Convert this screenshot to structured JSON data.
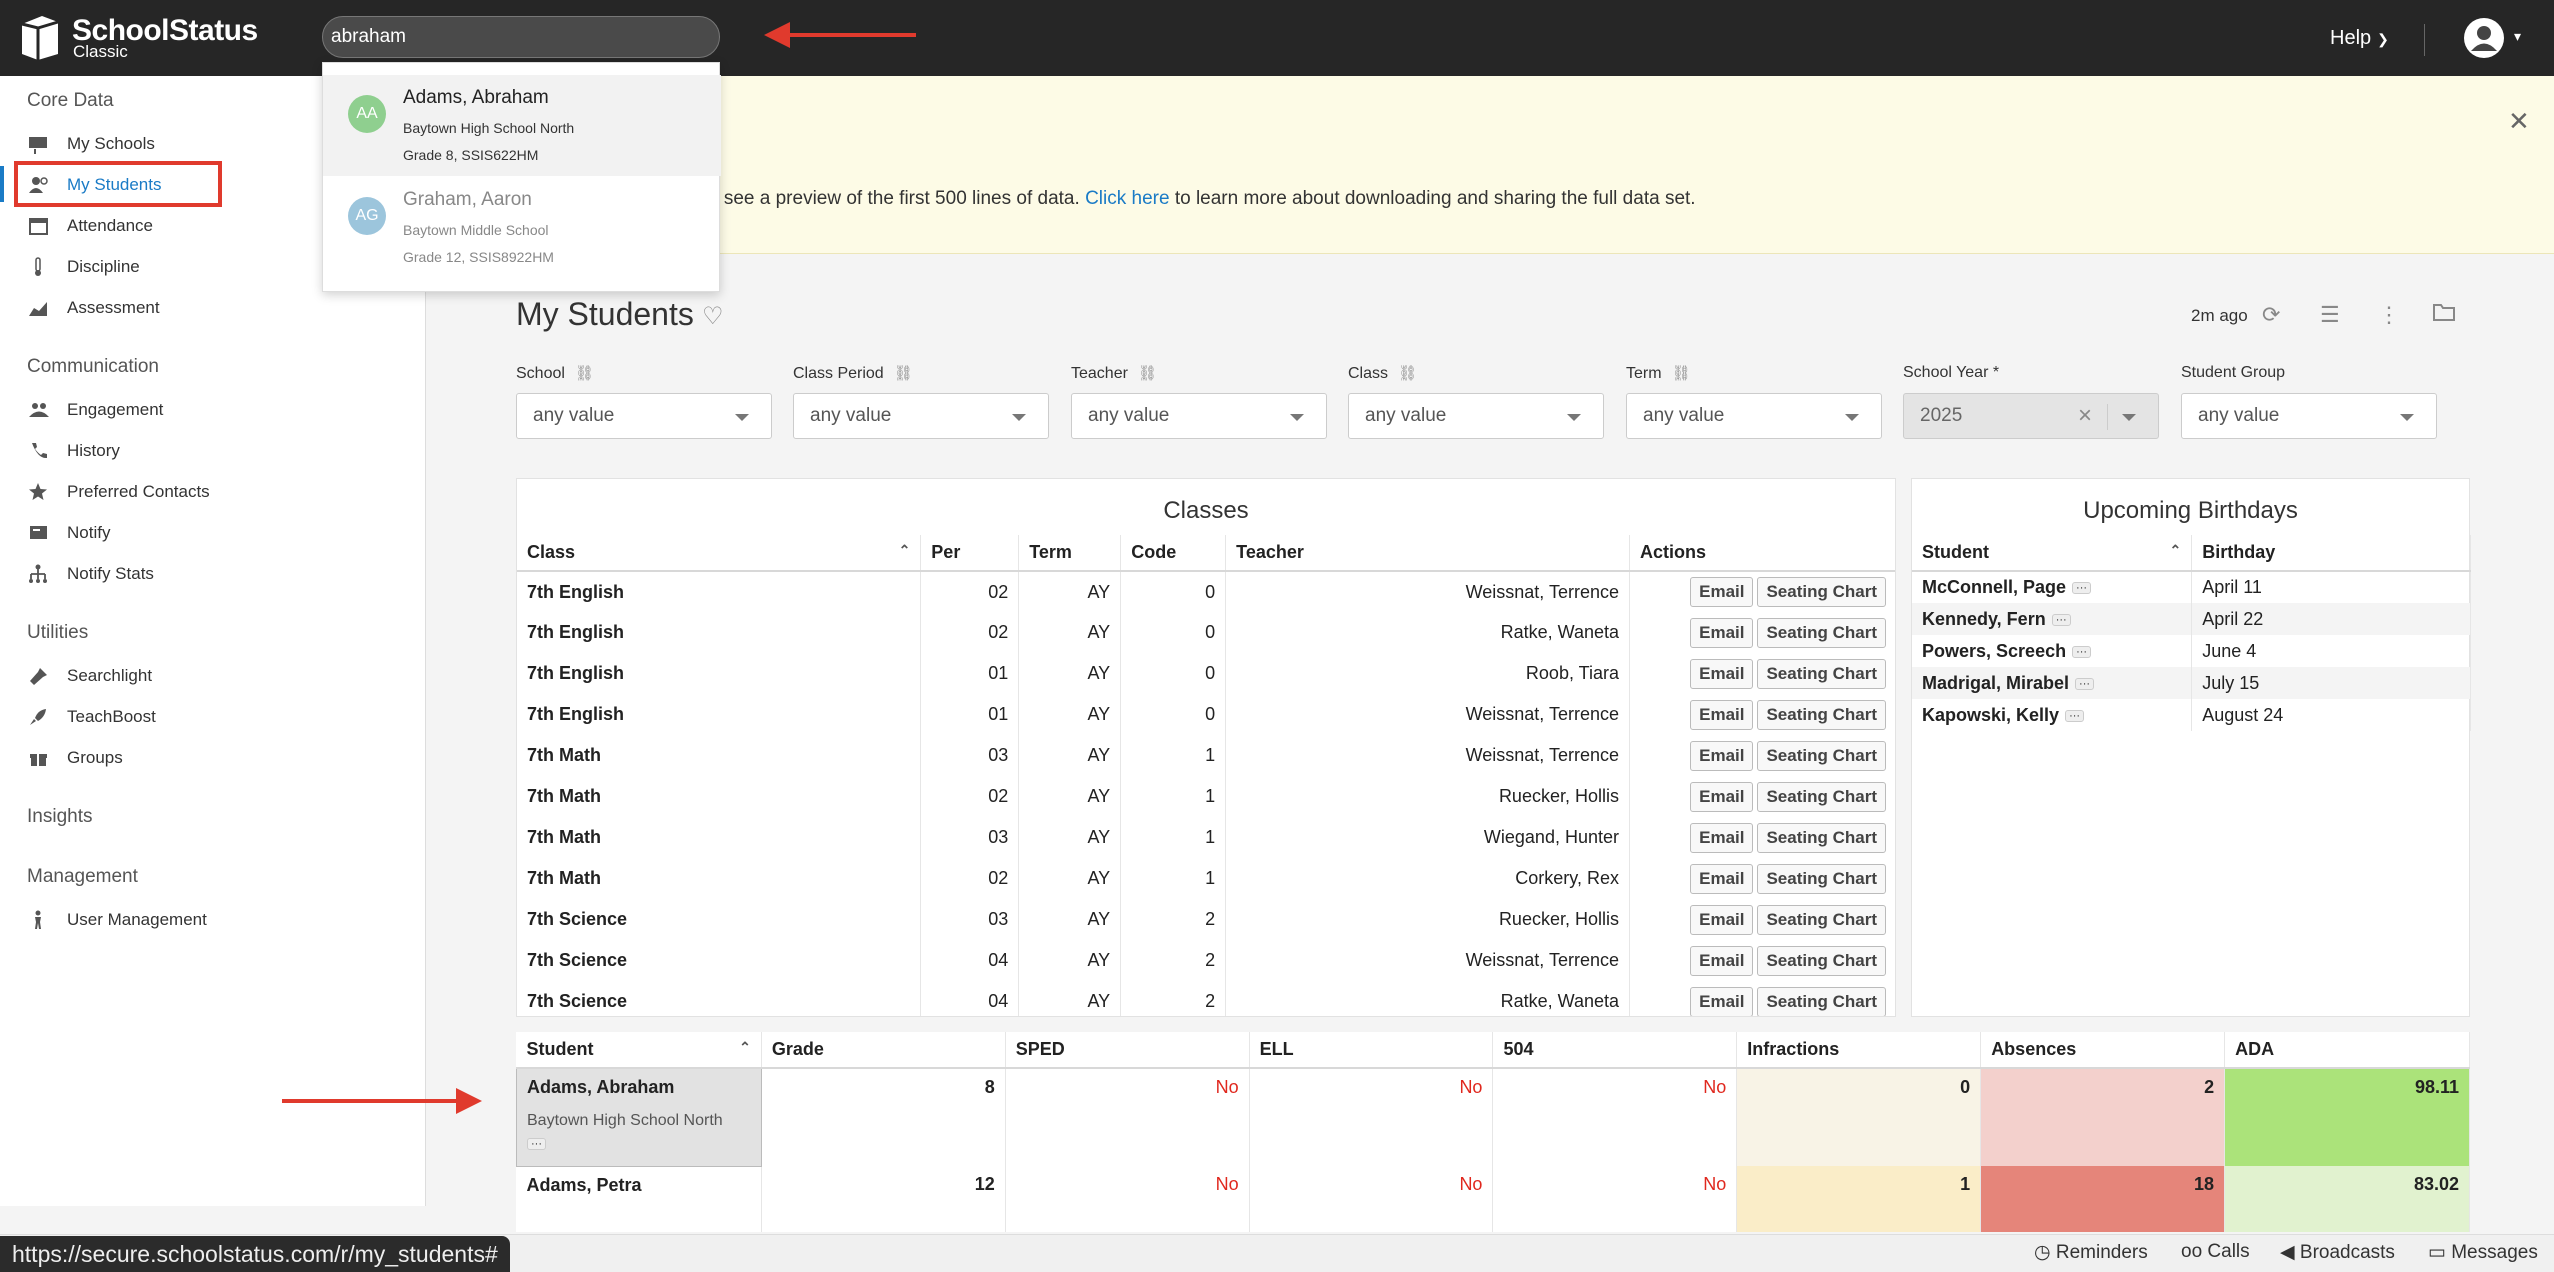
{
  "app": {
    "name": "SchoolStatus",
    "edition": "Classic"
  },
  "topbar": {
    "search_value": "abraham",
    "help_label": "Help"
  },
  "search_results": [
    {
      "initials": "AA",
      "name": "Adams, Abraham",
      "school": "Baytown High School North",
      "detail": "Grade 8, SSIS622HM",
      "color": "#8fcf8f"
    },
    {
      "initials": "AG",
      "name": "Graham, Aaron",
      "school": "Baytown Middle School",
      "detail": "Grade 12, SSIS8922HM",
      "color": "#9cc5dc"
    }
  ],
  "sidebar": {
    "sections": [
      {
        "label": "Core Data",
        "items": [
          "My Schools",
          "My Students",
          "Attendance",
          "Discipline",
          "Assessment"
        ]
      },
      {
        "label": "Communication",
        "items": [
          "Engagement",
          "History",
          "Preferred Contacts",
          "Notify",
          "Notify Stats"
        ]
      },
      {
        "label": "Utilities",
        "items": [
          "Searchlight",
          "TeachBoost",
          "Groups"
        ]
      },
      {
        "label": "Insights",
        "items": []
      },
      {
        "label": "Management",
        "items": [
          "User Management"
        ]
      }
    ]
  },
  "banner": {
    "text_before": "o see a preview of the first 500 lines of data. ",
    "link": "Click here",
    "text_after": " to learn more about downloading and sharing the full data set."
  },
  "page": {
    "title": "My Students",
    "updated": "2m ago"
  },
  "filters": [
    {
      "label": "School",
      "value": "any value"
    },
    {
      "label": "Class Period",
      "value": "any value"
    },
    {
      "label": "Teacher",
      "value": "any value"
    },
    {
      "label": "Class",
      "value": "any value"
    },
    {
      "label": "Term",
      "value": "any value"
    },
    {
      "label": "School Year *",
      "value": "2025"
    },
    {
      "label": "Student Group",
      "value": "any value"
    }
  ],
  "classes": {
    "title": "Classes",
    "headers": [
      "Class",
      "Per",
      "Term",
      "Code",
      "Teacher",
      "Actions"
    ],
    "email_label": "Email",
    "seating_label": "Seating Chart",
    "rows": [
      {
        "class": "7th English",
        "per": "02",
        "term": "AY",
        "code": "0",
        "teacher": "Weissnat, Terrence"
      },
      {
        "class": "7th English",
        "per": "02",
        "term": "AY",
        "code": "0",
        "teacher": "Ratke, Waneta"
      },
      {
        "class": "7th English",
        "per": "01",
        "term": "AY",
        "code": "0",
        "teacher": "Roob, Tiara"
      },
      {
        "class": "7th English",
        "per": "01",
        "term": "AY",
        "code": "0",
        "teacher": "Weissnat, Terrence"
      },
      {
        "class": "7th Math",
        "per": "03",
        "term": "AY",
        "code": "1",
        "teacher": "Weissnat, Terrence"
      },
      {
        "class": "7th Math",
        "per": "02",
        "term": "AY",
        "code": "1",
        "teacher": "Ruecker, Hollis"
      },
      {
        "class": "7th Math",
        "per": "03",
        "term": "AY",
        "code": "1",
        "teacher": "Wiegand, Hunter"
      },
      {
        "class": "7th Math",
        "per": "02",
        "term": "AY",
        "code": "1",
        "teacher": "Corkery, Rex"
      },
      {
        "class": "7th Science",
        "per": "03",
        "term": "AY",
        "code": "2",
        "teacher": "Ruecker, Hollis"
      },
      {
        "class": "7th Science",
        "per": "04",
        "term": "AY",
        "code": "2",
        "teacher": "Weissnat, Terrence"
      },
      {
        "class": "7th Science",
        "per": "04",
        "term": "AY",
        "code": "2",
        "teacher": "Ratke, Waneta"
      }
    ]
  },
  "birthdays": {
    "title": "Upcoming Birthdays",
    "headers": [
      "Student",
      "Birthday"
    ],
    "rows": [
      {
        "student": "McConnell, Page",
        "date": "April 11"
      },
      {
        "student": "Kennedy, Fern",
        "date": "April 22"
      },
      {
        "student": "Powers, Screech",
        "date": "June 4"
      },
      {
        "student": "Madrigal, Mirabel",
        "date": "July 15"
      },
      {
        "student": "Kapowski, Kelly",
        "date": "August 24"
      }
    ]
  },
  "students": {
    "headers": [
      "Student",
      "Grade",
      "SPED",
      "ELL",
      "504",
      "Infractions",
      "Absences",
      "ADA"
    ],
    "rows": [
      {
        "name": "Adams, Abraham",
        "school": "Baytown High School North",
        "grade": "8",
        "sped": "No",
        "ell": "No",
        "s504": "No",
        "infractions": "0",
        "absences": "2",
        "ada": "98.11",
        "inf_color": "#f8f3e6",
        "abs_color": "#f3d0cc",
        "ada_color": "#abe37a"
      },
      {
        "name": "Adams, Petra",
        "school": "",
        "grade": "12",
        "sped": "No",
        "ell": "No",
        "s504": "No",
        "infractions": "1",
        "absences": "18",
        "ada": "83.02",
        "inf_color": "#faedc8",
        "abs_color": "#e5857a",
        "ada_color": "#e1f2cf"
      }
    ]
  },
  "status_url": "https://secure.schoolstatus.com/r/my_students#",
  "bottom": {
    "reminders": "Reminders",
    "calls": "Calls",
    "broadcasts": "Broadcasts",
    "messages": "Messages"
  }
}
